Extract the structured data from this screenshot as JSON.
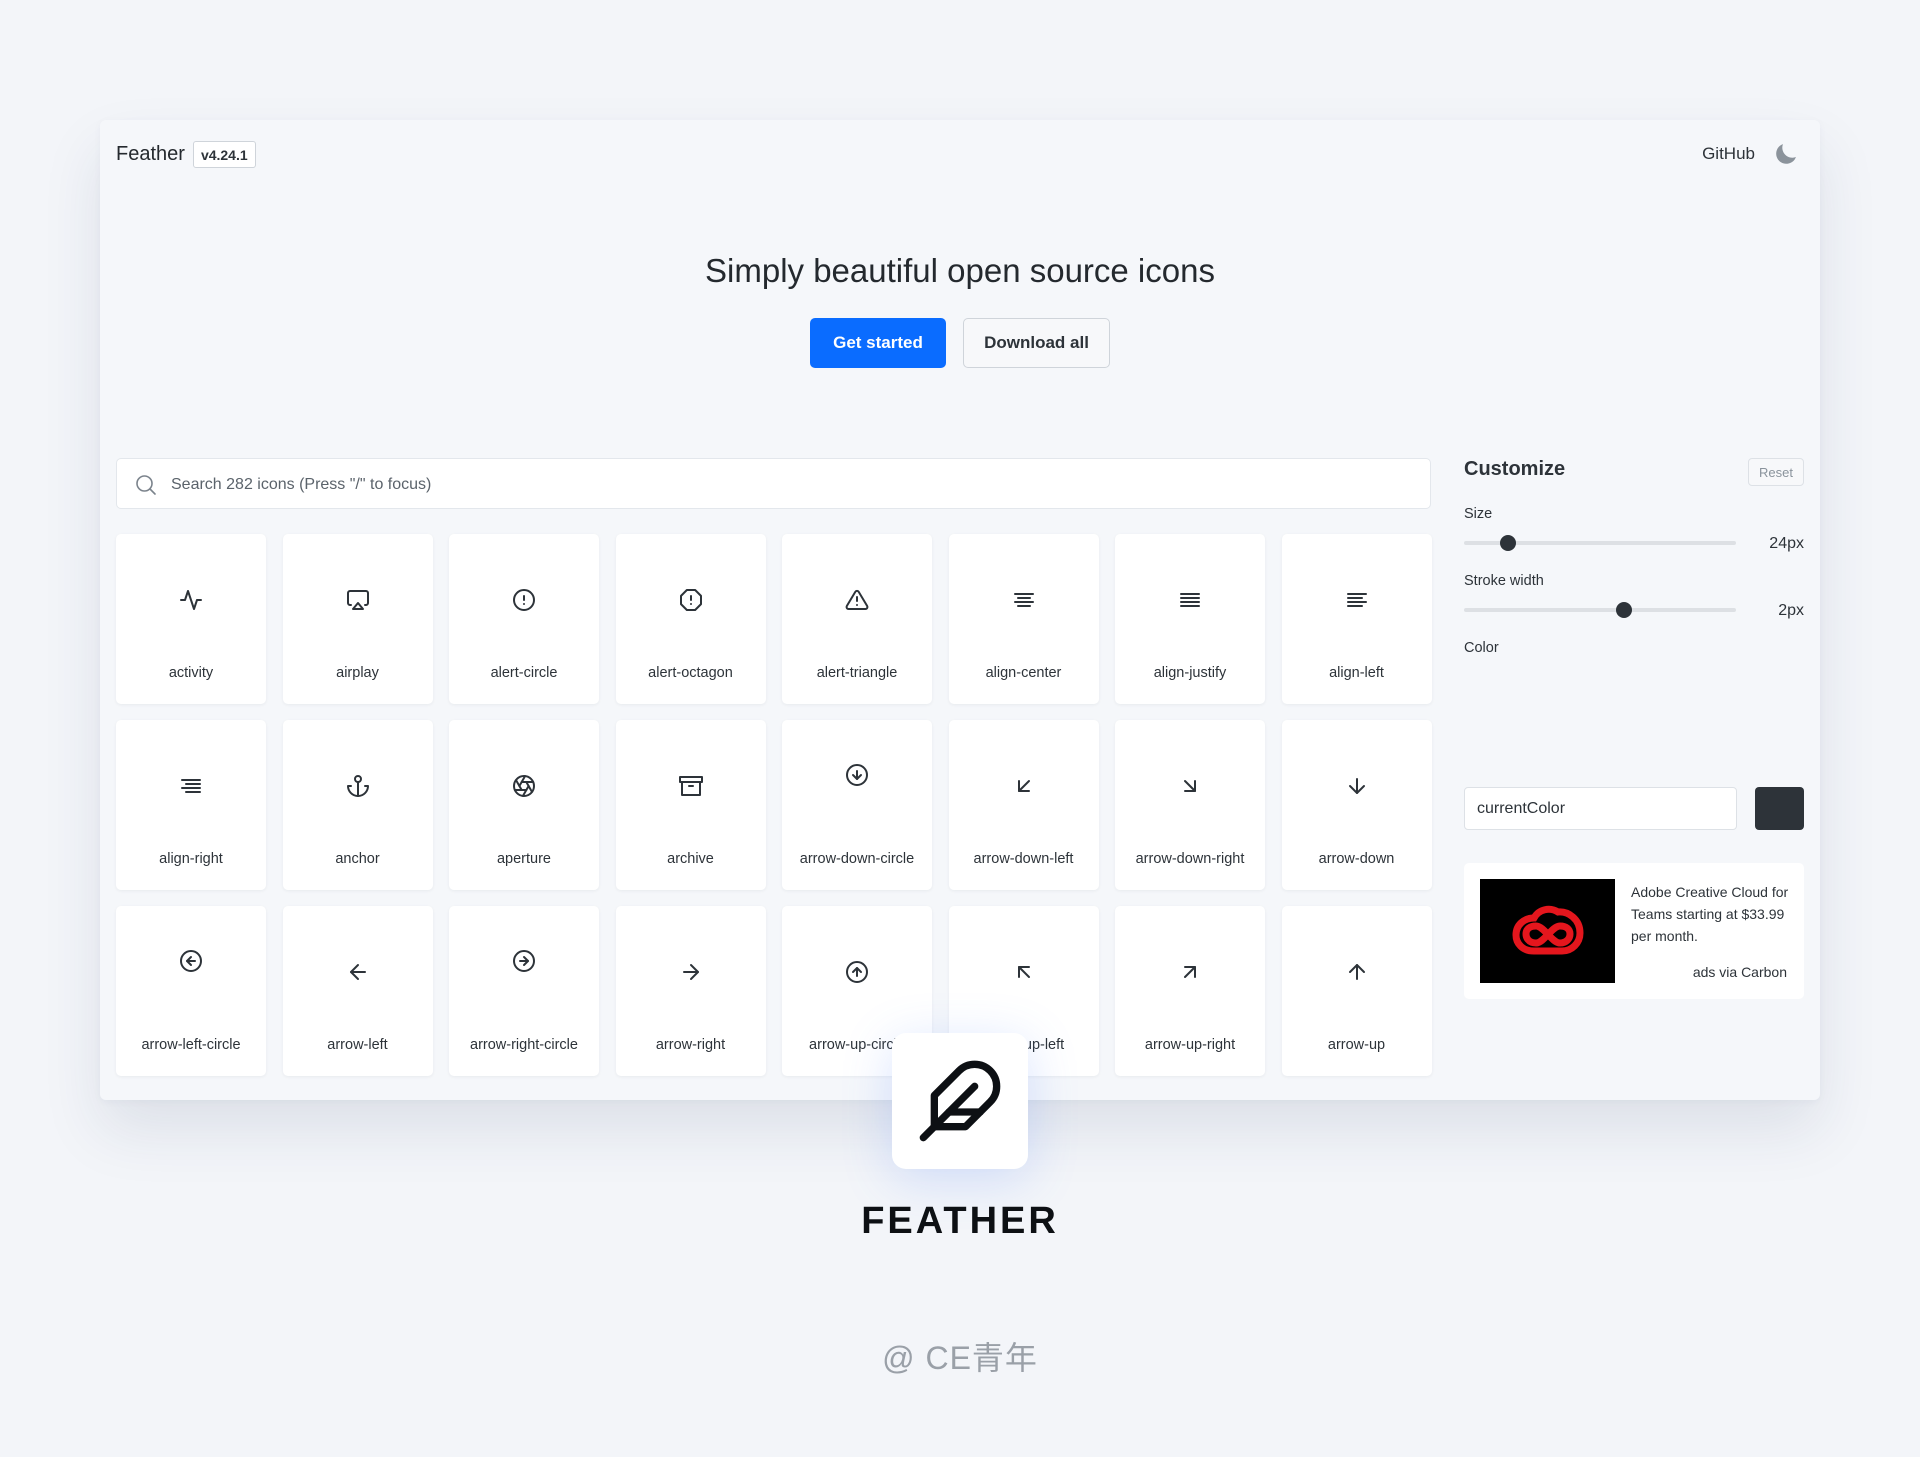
{
  "header": {
    "brand": "Feather",
    "version": "v4.24.1",
    "github_label": "GitHub",
    "theme_icon": "moon-icon"
  },
  "hero": {
    "title": "Simply beautiful open source icons",
    "primary_button": "Get started",
    "secondary_button": "Download all",
    "primary_color": "#0a6cff"
  },
  "search": {
    "placeholder": "Search 282 icons (Press \"/\" to focus)",
    "value": ""
  },
  "icons": [
    {
      "label": "activity",
      "icon": "activity"
    },
    {
      "label": "airplay",
      "icon": "airplay"
    },
    {
      "label": "alert-circle",
      "icon": "alert-circle"
    },
    {
      "label": "alert-octagon",
      "icon": "alert-octagon"
    },
    {
      "label": "alert-triangle",
      "icon": "alert-triangle"
    },
    {
      "label": "align-center",
      "icon": "align-center"
    },
    {
      "label": "align-justify",
      "icon": "align-justify"
    },
    {
      "label": "align-left",
      "icon": "align-left"
    },
    {
      "label": "align-right",
      "icon": "align-right"
    },
    {
      "label": "anchor",
      "icon": "anchor"
    },
    {
      "label": "aperture",
      "icon": "aperture"
    },
    {
      "label": "archive",
      "icon": "archive"
    },
    {
      "label": "arrow-down-circle",
      "icon": "arrow-down-circle"
    },
    {
      "label": "arrow-down-left",
      "icon": "arrow-down-left"
    },
    {
      "label": "arrow-down-right",
      "icon": "arrow-down-right"
    },
    {
      "label": "arrow-down",
      "icon": "arrow-down"
    },
    {
      "label": "arrow-left-circle",
      "icon": "arrow-left-circle"
    },
    {
      "label": "arrow-left",
      "icon": "arrow-left"
    },
    {
      "label": "arrow-right-circle",
      "icon": "arrow-right-circle"
    },
    {
      "label": "arrow-right",
      "icon": "arrow-right"
    },
    {
      "label": "arrow-up-circle",
      "icon": "arrow-up-circle"
    },
    {
      "label": "arrow-up-left",
      "icon": "arrow-up-left"
    },
    {
      "label": "arrow-up-right",
      "icon": "arrow-up-right"
    },
    {
      "label": "arrow-up",
      "icon": "arrow-up"
    }
  ],
  "customize": {
    "title": "Customize",
    "reset_label": "Reset",
    "size_label": "Size",
    "size_value": "24px",
    "size_level": 0.16,
    "stroke_label": "Stroke width",
    "stroke_value": "2px",
    "stroke_level": 0.59,
    "color_label": "Color",
    "color_value": "currentColor",
    "swatch_color": "#2d3339"
  },
  "ad": {
    "text": "Adobe Creative Cloud for Teams starting at $33.99 per month.",
    "via": "ads via Carbon",
    "image_icon": "creative-cloud-logo"
  },
  "footer": {
    "logo_icon": "feather-icon",
    "title": "FEATHER",
    "credit": "@ CE青年"
  }
}
